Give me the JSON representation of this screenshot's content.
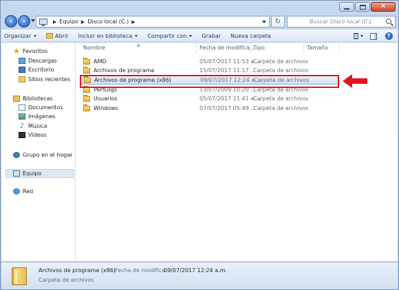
{
  "window": {
    "address": {
      "crumbs": [
        "Equipo",
        "Disco local (C:)"
      ],
      "search_placeholder": "Buscar Disco local (C:)"
    },
    "caption_buttons": [
      "minimize",
      "maximize",
      "close"
    ]
  },
  "toolbar": {
    "organize": "Organizar",
    "open": "Abrir",
    "include": "Incluir en biblioteca",
    "share": "Compartir con",
    "burn": "Grabar",
    "new_folder": "Nueva carpeta"
  },
  "nav": {
    "favorites": {
      "label": "Favoritos",
      "items": [
        "Descargas",
        "Escritorio",
        "Sitios recientes"
      ]
    },
    "libraries": {
      "label": "Bibliotecas",
      "items": [
        "Documentos",
        "Imágenes",
        "Música",
        "Vídeos"
      ]
    },
    "homegroup": "Grupo en el hogar",
    "computer": "Equipo",
    "network": "Red"
  },
  "columns": {
    "name": "Nombre",
    "date": "Fecha de modifica...",
    "type": "Tipo",
    "size": "Tamaño"
  },
  "files": [
    {
      "name": "AMD",
      "date": "05/07/2017 11:53 a....",
      "type": "Carpeta de archivos"
    },
    {
      "name": "Archivos de programa",
      "date": "15/07/2017 11:17 ...",
      "type": "Carpeta de archivos"
    },
    {
      "name": "Archivos de programa (x86)",
      "date": "09/07/2017 12:24 a....",
      "type": "Carpeta de archivos",
      "selected": true
    },
    {
      "name": "PerfLogs",
      "date": "13/07/2009 10:20 ...",
      "type": "Carpeta de archivos"
    },
    {
      "name": "Usuarios",
      "date": "05/07/2017 11:41 a....",
      "type": "Carpeta de archivos"
    },
    {
      "name": "Windows",
      "date": "07/07/2017 05:49 ...",
      "type": "Carpeta de archivos"
    }
  ],
  "details": {
    "name": "Archivos de programa (x86)",
    "date_label": "Fecha de modifica...",
    "date_value": "09/07/2017 12:24 a.m.",
    "type": "Carpeta de archivos"
  },
  "annotation": {
    "highlight_color": "#e3141b",
    "arrow_color": "#e3141b"
  }
}
